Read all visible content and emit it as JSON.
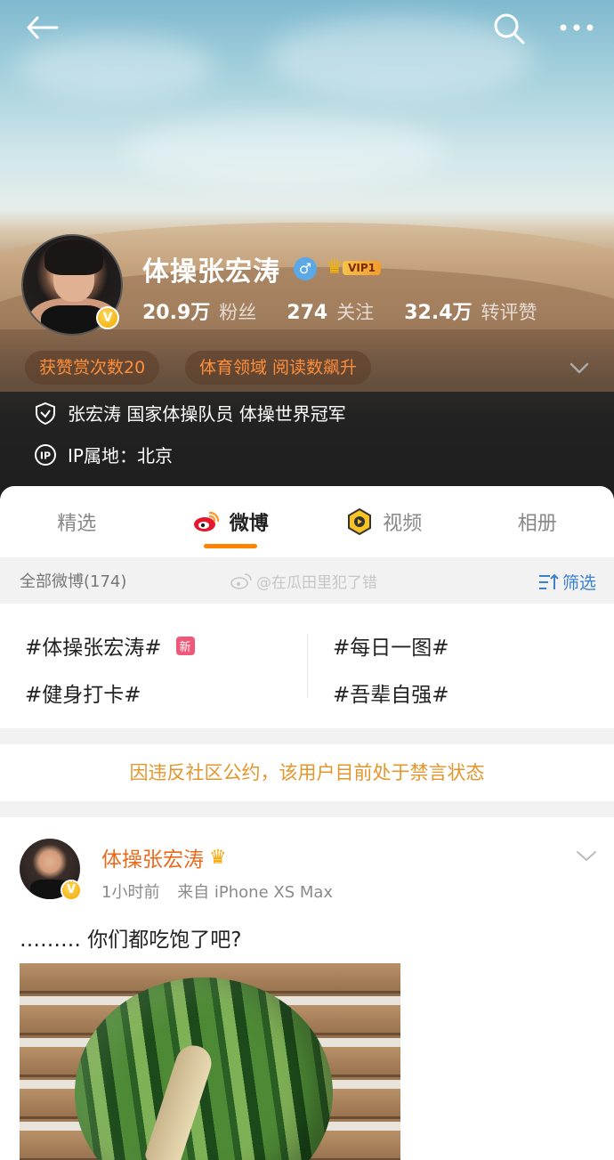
{
  "profile": {
    "name": "体操张宏涛",
    "gender_symbol": "♂",
    "vip_label": "VIP1",
    "verified_badge": "V",
    "stats": [
      {
        "value": "20.9万",
        "label": "粉丝"
      },
      {
        "value": "274",
        "label": "关注"
      },
      {
        "value": "32.4万",
        "label": "转评赞"
      }
    ],
    "tags": [
      "获赞赏次数20",
      "体育领域 阅读数飙升"
    ],
    "bio": "张宏涛 国家体操队员 体操世界冠军",
    "ip_location": "IP属地：北京"
  },
  "tabs": [
    {
      "label": "精选",
      "icon": ""
    },
    {
      "label": "微博",
      "icon": "weibo-logo-icon"
    },
    {
      "label": "视频",
      "icon": "video-icon"
    },
    {
      "label": "相册",
      "icon": ""
    }
  ],
  "filter_bar": {
    "count_label": "全部微博(174)",
    "watermark": "@在瓜田里犯了错",
    "filter_label": "筛选"
  },
  "topics": [
    {
      "text": "#体操张宏涛#",
      "badge": "新"
    },
    {
      "text": "#每日一图#",
      "badge": ""
    },
    {
      "text": "#健身打卡#",
      "badge": ""
    },
    {
      "text": "#吾辈自强#",
      "badge": ""
    }
  ],
  "ban_notice": "因违反社区公约，该用户目前处于禁言状态",
  "post": {
    "author": "体操张宏涛",
    "time": "1小时前",
    "source": "来自 iPhone XS Max",
    "text": "……… 你们都吃饱了吧?"
  },
  "colors": {
    "accent_orange": "#ff8200",
    "link_blue": "#3b7fd1",
    "ban_text": "#e2962c",
    "tag_text": "#ff8e3a",
    "author_name": "#e86a1a"
  }
}
